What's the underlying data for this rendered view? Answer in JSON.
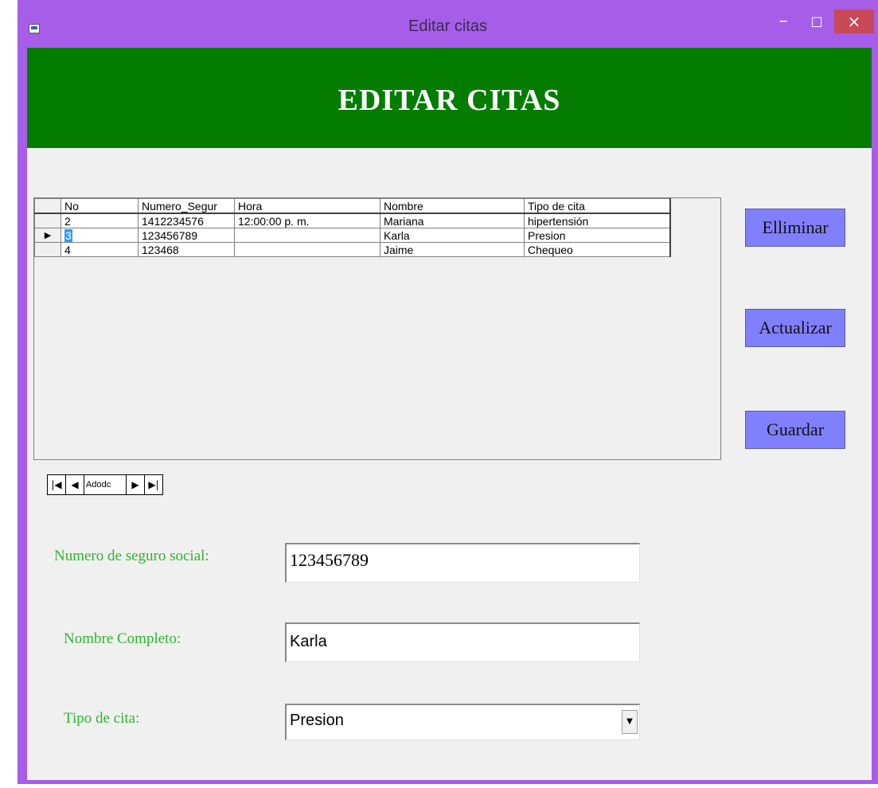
{
  "window": {
    "title": "Editar citas",
    "controls": {
      "minimize": "–",
      "maximize": "□",
      "close": "×"
    }
  },
  "banner": {
    "title": "EDITAR CITAS"
  },
  "grid": {
    "columns": [
      "No",
      "Numero_Segur",
      "Hora",
      "Nombre",
      "Tipo de cita"
    ],
    "rows": [
      {
        "no": "2",
        "numero_seguro": "1412234576",
        "hora": "12:00:00 p. m.",
        "nombre": "Mariana",
        "tipo": "hipertensión"
      },
      {
        "no": "3",
        "numero_seguro": "123456789",
        "hora": "",
        "nombre": "Karla",
        "tipo": "Presion"
      },
      {
        "no": "4",
        "numero_seguro": "123468",
        "hora": "",
        "nombre": "Jaime",
        "tipo": "Chequeo"
      }
    ],
    "current_row_marker": "▶"
  },
  "buttons": {
    "delete": "Elliminar",
    "update": "Actualizar",
    "save": "Guardar"
  },
  "navigator": {
    "caption": "Adodc",
    "first": "|◀",
    "prev": "◀",
    "next": "▶",
    "last": "▶|"
  },
  "form": {
    "ssn_label": "Numero de seguro social:",
    "ssn_value": "123456789",
    "name_label": "Nombre Completo:",
    "name_value": "Karla",
    "type_label": "Tipo de cita:",
    "type_value": "Presion"
  },
  "colors": {
    "titlebar": "#a65ee8",
    "banner": "#047c00",
    "button": "#8080ff",
    "label": "#2fb52f",
    "close": "#c74a56"
  }
}
